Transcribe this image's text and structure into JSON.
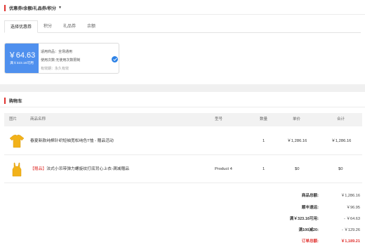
{
  "coupon_section": {
    "title": "优惠券/余额/礼品券/积分",
    "tabs": [
      "选择优惠券",
      "积分",
      "礼品券",
      "余额"
    ],
    "coupon": {
      "amount": "￥64.63",
      "condition": "满￥323.16可用",
      "scope": "适用商品：全场通用",
      "usage": "使用次数:无使用次数限制",
      "validity": "有效期：永久有效"
    }
  },
  "cart": {
    "title": "购物车",
    "columns": [
      "图片",
      "商品名称",
      "型号",
      "数量",
      "单价",
      "合计"
    ],
    "rows": [
      {
        "name": "春夏新款纯棉针织短袖宽松纯色T恤 - 赠品活动",
        "gift_tag": "",
        "model": "",
        "qty": "1",
        "price": "￥1,286.16",
        "total": "￥1,286.16"
      },
      {
        "name": "法式小吊带弹力螺旋纹打底背心上衣-满减赠品",
        "gift_tag": "【赠品】",
        "model": "Product 4",
        "qty": "1",
        "price": "$0",
        "total": "$0"
      }
    ]
  },
  "summary": [
    {
      "label": "商品总额:",
      "value": "￥1,286.16"
    },
    {
      "label": "顺丰速运:",
      "value": "￥96.95"
    },
    {
      "label": "满￥323.16可用:",
      "value": "- ￥64.63"
    },
    {
      "label": "满100减20:",
      "value": "- ￥129.26"
    },
    {
      "label": "订单总额:",
      "value": "￥1,189.21"
    }
  ],
  "colors": {
    "accent": "#e0322f",
    "coupon_blue": "#4f90ee",
    "check_blue": "#2d82e6",
    "product_yellow": "#f2b21a"
  },
  "icons": [
    "chevron-down-icon",
    "check-icon",
    "tshirt-icon",
    "camisole-icon"
  ]
}
